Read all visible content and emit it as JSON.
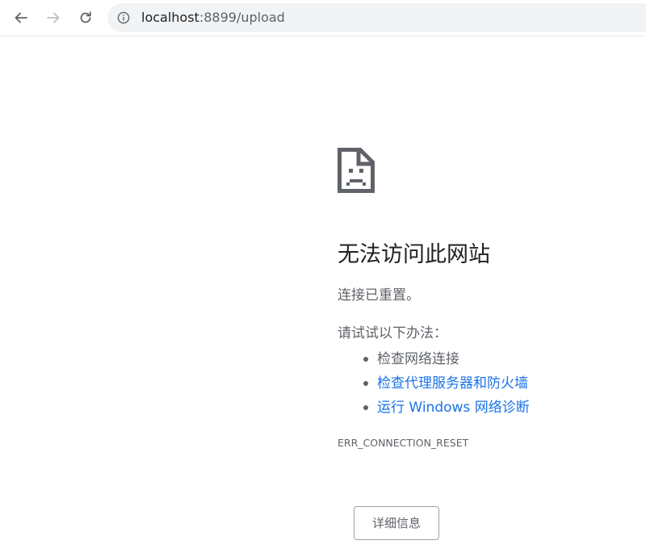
{
  "browser": {
    "url_host": "localhost",
    "url_rest": ":8899/upload",
    "icons": {
      "back": "arrow-left-icon",
      "forward": "arrow-right-icon",
      "reload": "reload-icon",
      "site_info": "info-icon"
    }
  },
  "error_page": {
    "icon": "sad-page-icon",
    "title": "无法访问此网站",
    "subtitle": "连接已重置。",
    "try_heading": "请试试以下办法：",
    "suggestions": [
      {
        "label": "检查网络连接",
        "link": false
      },
      {
        "label": "检查代理服务器和防火墙",
        "link": true
      },
      {
        "label": "运行 Windows 网络诊断",
        "link": true
      }
    ],
    "error_code": "ERR_CONNECTION_RESET",
    "details_button": "详细信息"
  },
  "colors": {
    "link": "#1a73e8",
    "text_primary": "#202124",
    "text_secondary": "#5f6368",
    "omnibox_bg": "#f1f3f4"
  }
}
